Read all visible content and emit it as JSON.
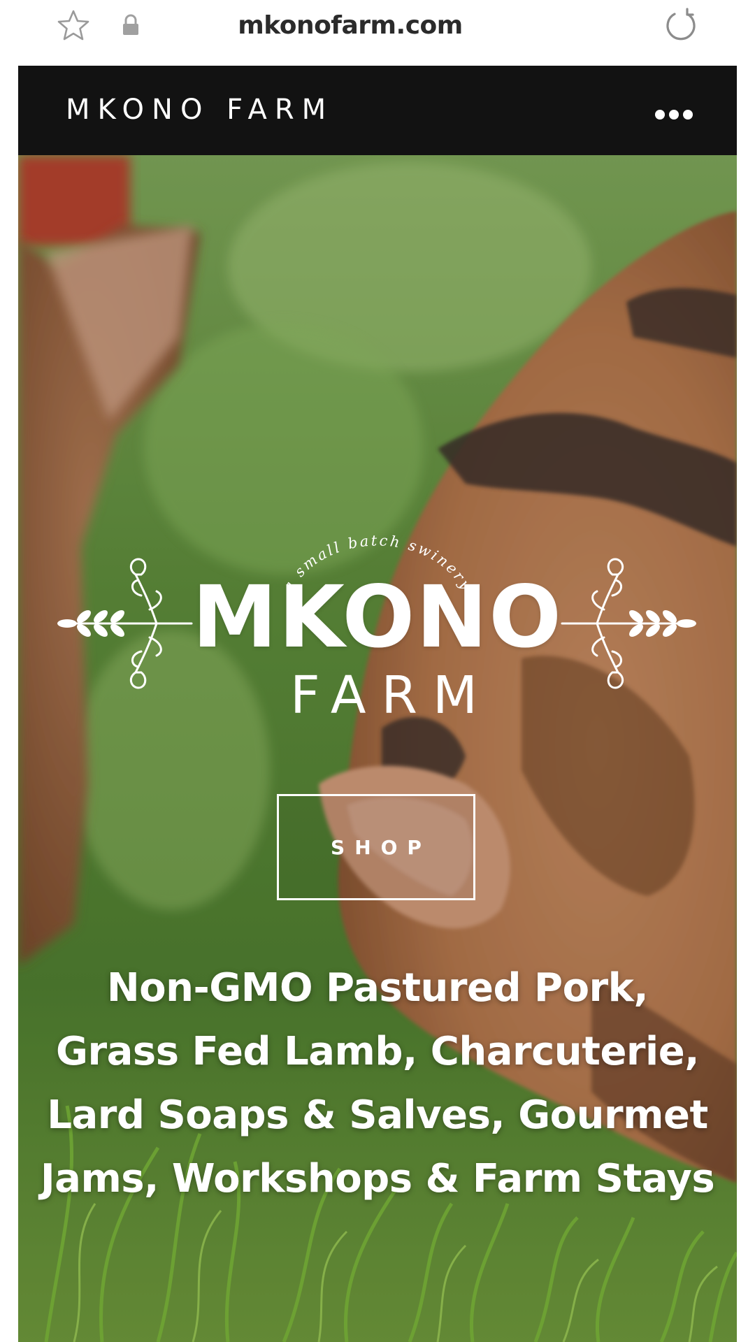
{
  "browser": {
    "url": "mkonofarm.com",
    "icons": {
      "bookmark": "star-icon",
      "secure": "lock-icon",
      "reload": "reload-icon"
    }
  },
  "header": {
    "site_name": "MKONO FARM",
    "menu_icon": "more-dots-icon"
  },
  "hero": {
    "logo": {
      "tagline": "a small batch swinery",
      "name": "MKONO",
      "sub": "FARM"
    },
    "shop_label": "SHOP",
    "description": "Non-GMO Pastured Pork, Grass Fed Lamb, Charcuterie, Lard Soaps & Salves, Gourmet Jams, Workshops & Farm Stays"
  },
  "colors": {
    "header_bg": "#121212",
    "text_light": "#ffffff",
    "url_text": "#2b2b2b"
  }
}
